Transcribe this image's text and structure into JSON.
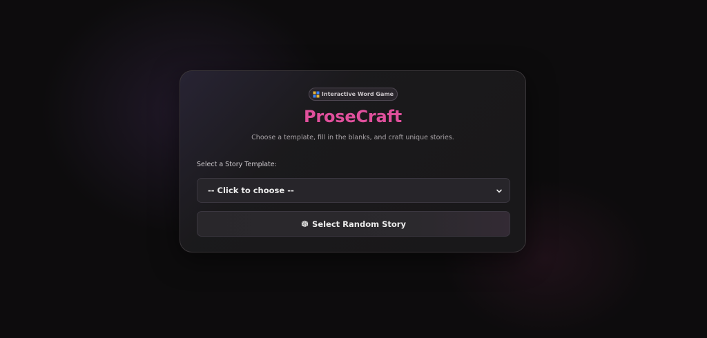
{
  "badge": {
    "icon": "puzzle-icon",
    "text": "Interactive Word Game"
  },
  "title": "ProseCraft",
  "subtitle": "Choose a template, fill in the blanks, and craft unique stories.",
  "template_select": {
    "label": "Select a Story Template:",
    "selected_value": "-- Click to choose --"
  },
  "random_button": {
    "icon": "dice-icon",
    "label": "Select Random Story"
  },
  "colors": {
    "accent": "#e0509c",
    "background": "#0d0c0d",
    "card": "#1c1b1d"
  }
}
